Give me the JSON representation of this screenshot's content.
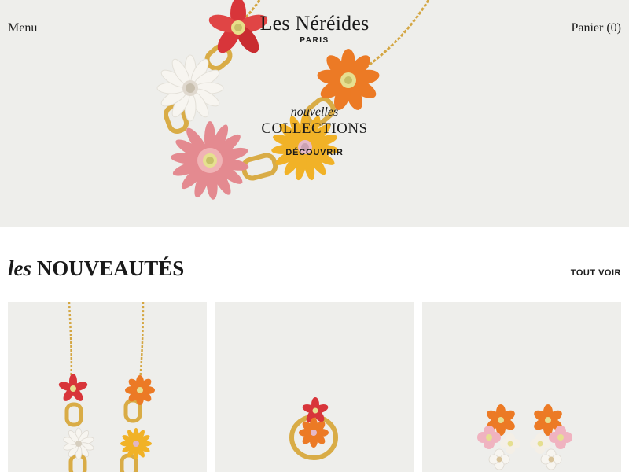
{
  "header": {
    "menu_label": "Menu",
    "cart_label": "Panier (0)",
    "brand_name": "Les Néréides",
    "brand_city": "PARIS"
  },
  "hero": {
    "kicker": "nouvelles",
    "title": "COLLECTIONS",
    "cta_label": "DÉCOUVRIR"
  },
  "new_arrivals": {
    "title_italic": "les",
    "title_main": "NOUVEAUTÉS",
    "see_all_label": "TOUT VOIR",
    "products": [
      {
        "image": "flower-necklace"
      },
      {
        "image": "flower-ring"
      },
      {
        "image": "flower-earrings"
      }
    ]
  },
  "colors": {
    "hero_background": "#eeeeeb",
    "gold": "#d4a642",
    "flower_red": "#d8353a",
    "flower_orange": "#ec7a25",
    "flower_white": "#f7f5f0",
    "flower_pink": "#e48a90",
    "flower_yellow": "#f1b227"
  }
}
